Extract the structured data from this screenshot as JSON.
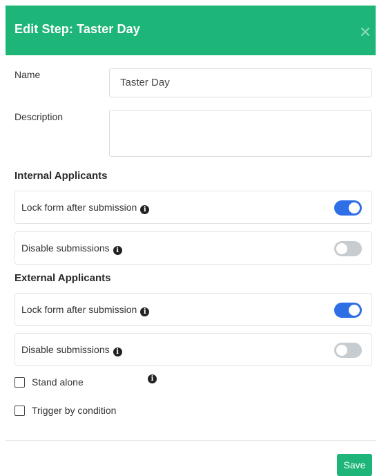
{
  "header": {
    "title": "Edit Step: Taster Day",
    "close_icon": "close-icon"
  },
  "form": {
    "name_label": "Name",
    "name_value": "Taster Day",
    "description_label": "Description",
    "description_value": ""
  },
  "internal": {
    "heading": "Internal Applicants",
    "lock_label": "Lock form after submission",
    "lock_enabled": true,
    "disable_label": "Disable submissions",
    "disable_enabled": false
  },
  "external": {
    "heading": "External Applicants",
    "lock_label": "Lock form after submission",
    "lock_enabled": true,
    "disable_label": "Disable submissions",
    "disable_enabled": false
  },
  "options": {
    "stand_alone_label": "Stand alone",
    "stand_alone_checked": false,
    "trigger_label": "Trigger by condition",
    "trigger_checked": false
  },
  "footer": {
    "save_label": "Save"
  },
  "colors": {
    "accent": "#1db578",
    "toggle_on": "#2f6fe6",
    "toggle_off": "#c7ccd1"
  }
}
